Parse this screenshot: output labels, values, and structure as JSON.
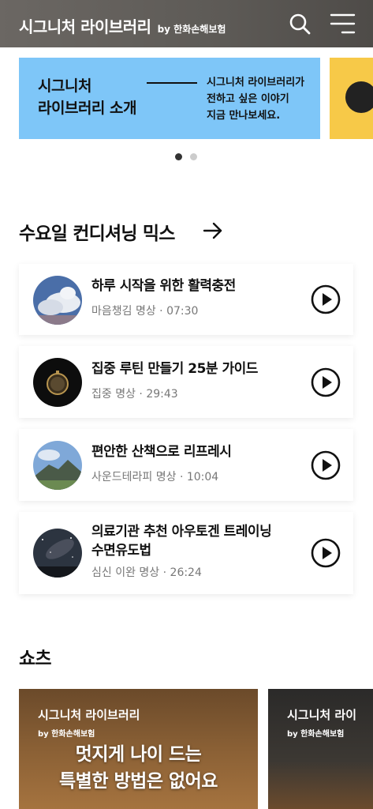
{
  "header": {
    "title": "시그니처 라이브러리",
    "by": "by 한화손해보험",
    "search_icon": "search-icon",
    "menu_icon": "hamburger-menu-icon"
  },
  "banner": {
    "title_line1": "시그니처",
    "title_line2": "라이브러리 소개",
    "desc_line1": "시그니처 라이브러리가",
    "desc_line2": "전하고 싶은 이야기",
    "desc_line3": "지금 만나보세요.",
    "bg_color": "#7ec6f8",
    "next_bg_color": "#f7c948",
    "page_count": 2,
    "active_page": 1
  },
  "mix_section": {
    "title": "수요일 컨디셔닝 믹스",
    "items": [
      {
        "title": "하루 시작을 위한 활력충전",
        "meta": "마음챙김 명상 · 07:30",
        "thumb": "sky-clouds"
      },
      {
        "title": "집중 루틴 만들기 25분 가이드",
        "meta": "집중 명상 · 29:43",
        "thumb": "pocket-watch"
      },
      {
        "title": "편안한 산책으로 리프레시",
        "meta": "사운드테라피 명상 · 10:04",
        "thumb": "mountain"
      },
      {
        "title_line1": "의료기관 추천 아우토겐 트레이닝",
        "title_line2": "수면유도법",
        "meta": "심신 이완 명상 · 26:24",
        "thumb": "starry-night"
      }
    ]
  },
  "shorts_section": {
    "title": "쇼츠",
    "items": [
      {
        "brand": "시그니처 라이브러리",
        "by": "by 한화손해보험",
        "headline_line1": "멋지게 나이 드는",
        "headline_line2": "특별한 방법은 없어요"
      },
      {
        "brand": "시그니처 라이",
        "by": "by 한화손해보험"
      }
    ]
  }
}
